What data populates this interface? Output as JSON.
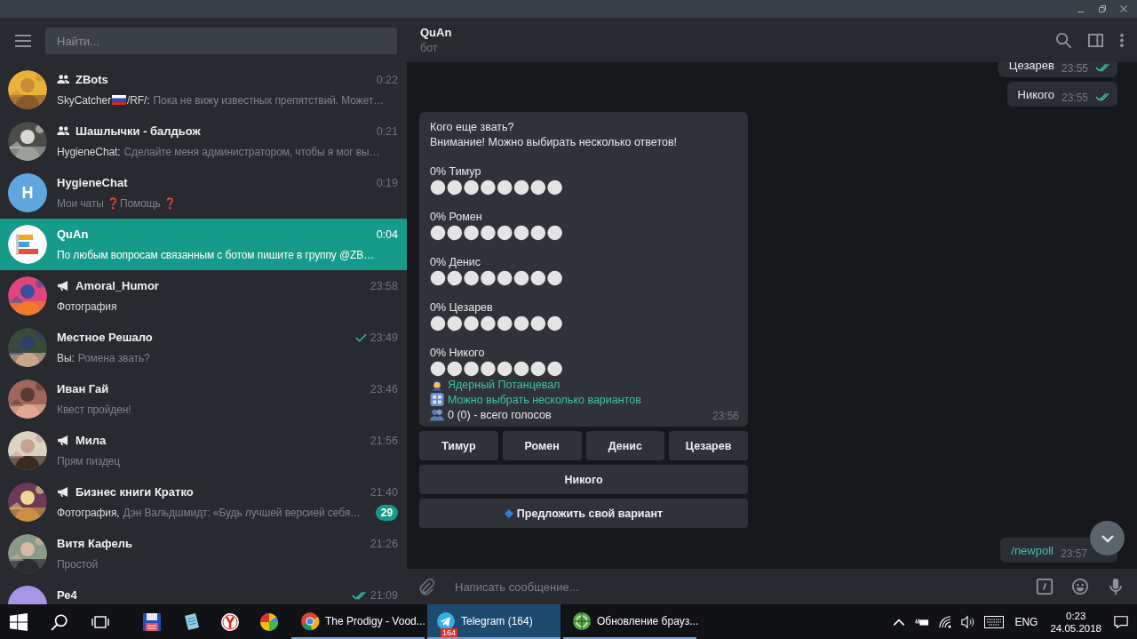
{
  "sidebar": {
    "search": {
      "placeholder": "Найти..."
    },
    "chats": [
      {
        "kind": "group",
        "name": "ZBots",
        "time": "0:22",
        "sent": false,
        "read": false,
        "sender": "SkyCatcher",
        "flag": true,
        "sender_tail": "/RF/:",
        "preview": "Пока не вижу известных препятствий. Может…",
        "selected": false
      },
      {
        "kind": "group",
        "name": "Шашлычки - балдьож",
        "time": "0:21",
        "sent": false,
        "read": false,
        "sender": "HygieneChat:",
        "preview": "Сделайте меня администратором, чтобы я мог вы…",
        "selected": false
      },
      {
        "kind": "user",
        "name": "HygieneChat",
        "time": "0:19",
        "sent": false,
        "read": false,
        "preview": "Мои чаты ❓Помощь ❓",
        "selected": false,
        "avatar": {
          "kind": "letter",
          "letter": "H",
          "color": "#5ea6dd"
        }
      },
      {
        "kind": "user",
        "name": "QuAn",
        "time": "0:04",
        "sent": false,
        "read": false,
        "preview": "По любым вопросам связанным с ботом пишите в группу @ZB…",
        "selected": true,
        "avatar": {
          "kind": "logo"
        }
      },
      {
        "kind": "channel",
        "name": "Amoral_Humor",
        "time": "23:58",
        "sent": false,
        "read": false,
        "sender": "Фотография",
        "selected": false
      },
      {
        "kind": "user",
        "name": "Местное Решало",
        "time": "23:49",
        "sent": true,
        "read": false,
        "sender": "Вы:",
        "preview": "Ромена звать?",
        "selected": false
      },
      {
        "kind": "user",
        "name": "Иван Гай",
        "time": "23:46",
        "sent": false,
        "read": false,
        "preview": "Квест пройден!",
        "selected": false
      },
      {
        "kind": "channel",
        "name": "Мила",
        "time": "21:56",
        "sent": false,
        "read": false,
        "preview": "Прям пиздец",
        "selected": false
      },
      {
        "kind": "channel",
        "name": "Бизнес книги Кратко",
        "time": "21:40",
        "sent": false,
        "read": false,
        "sender": "Фотография,",
        "preview": "Дэн Вальдшмидт: «Будь лучшей версией себя…",
        "unread": "29",
        "selected": false
      },
      {
        "kind": "user",
        "name": "Витя Кафель",
        "time": "21:26",
        "sent": false,
        "read": false,
        "preview": "Простой",
        "selected": false
      },
      {
        "kind": "user",
        "name": "Ре4",
        "time": "21:09",
        "sent": true,
        "read": true,
        "selected": false,
        "avatar": {
          "kind": "letter",
          "color": "#a695e7"
        }
      }
    ]
  },
  "chat": {
    "title": "QuAn",
    "subtitle": "бот",
    "messages": [
      {
        "kind": "outgoing",
        "text": "Цезарев",
        "time": "23:55",
        "read": true
      },
      {
        "kind": "outgoing",
        "text": "Никого",
        "time": "23:55",
        "read": true
      },
      {
        "kind": "poll",
        "lines": [
          "Кого еще звать?",
          "Внимание! Можно выбирать несколько ответов!"
        ],
        "options": [
          {
            "label": "0% Тимур"
          },
          {
            "label": "0% Ромен"
          },
          {
            "label": "0% Денис"
          },
          {
            "label": "0% Цезарев"
          },
          {
            "label": "0% Никого"
          }
        ],
        "footer": [
          {
            "kind": "author",
            "text": "Ядерный Потанцевал"
          },
          {
            "kind": "mode",
            "text": "Можно выбрать несколько вариантов"
          },
          {
            "kind": "votes",
            "text": "0 (0) - всего голосов"
          }
        ],
        "time": "23:56",
        "keyboard": [
          [
            {
              "label": "Тимур"
            },
            {
              "label": "Ромен"
            },
            {
              "label": "Денис"
            },
            {
              "label": "Цезарев"
            }
          ],
          [
            {
              "label": "Никого"
            }
          ],
          [
            {
              "label": "Предложить свой вариант",
              "kind": "suggest"
            }
          ]
        ]
      },
      {
        "kind": "command",
        "text": "/newpoll",
        "time": "23:57"
      }
    ],
    "input": {
      "placeholder": "Написать сообщение..."
    }
  },
  "taskbar": {
    "items": [
      {
        "kind": "floppy"
      },
      {
        "kind": "notepad"
      },
      {
        "kind": "ybrowser"
      },
      {
        "kind": "ball"
      },
      {
        "kind": "chrome",
        "label": "The Prodigy - Vood...",
        "selected": false
      },
      {
        "kind": "telegram",
        "label": "Telegram (164)",
        "badge": "164",
        "selected": true
      },
      {
        "kind": "globe",
        "label": "Обновление брауз...",
        "selected": false
      }
    ],
    "language": "ENG",
    "time": "0:23",
    "date": "24.05.2018"
  }
}
